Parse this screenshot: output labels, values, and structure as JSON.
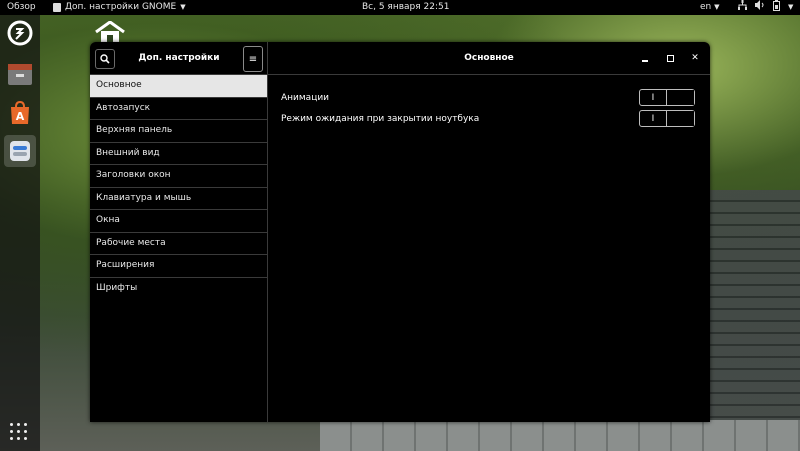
{
  "topbar": {
    "overview": "Обзор",
    "app_menu": "Доп. настройки GNOME",
    "clock": "Вс, 5 января  22:51",
    "lang": "en"
  },
  "dock": {
    "items": [
      {
        "icon": "backup-icon"
      },
      {
        "icon": "files-icon"
      },
      {
        "icon": "software-icon"
      },
      {
        "icon": "tweaks-icon"
      }
    ]
  },
  "window": {
    "app_title": "Доп. настройки GNOME",
    "main_title": "Основное",
    "sidebar": {
      "items": [
        {
          "label": "Основное"
        },
        {
          "label": "Автозапуск"
        },
        {
          "label": "Верхняя панель"
        },
        {
          "label": "Внешний вид"
        },
        {
          "label": "Заголовки окон"
        },
        {
          "label": "Клавиатура и мышь"
        },
        {
          "label": "Окна"
        },
        {
          "label": "Рабочие места"
        },
        {
          "label": "Расширения"
        },
        {
          "label": "Шрифты"
        }
      ],
      "selected_index": 0
    },
    "settings": [
      {
        "label": "Анимации",
        "toggle_text": "I"
      },
      {
        "label": "Режим ожидания при закрытии ноутбука",
        "toggle_text": "I"
      }
    ]
  },
  "colors": {
    "window_bg": "#000000",
    "selected_bg": "#e6e6e6",
    "separator": "#3a3a3a"
  }
}
